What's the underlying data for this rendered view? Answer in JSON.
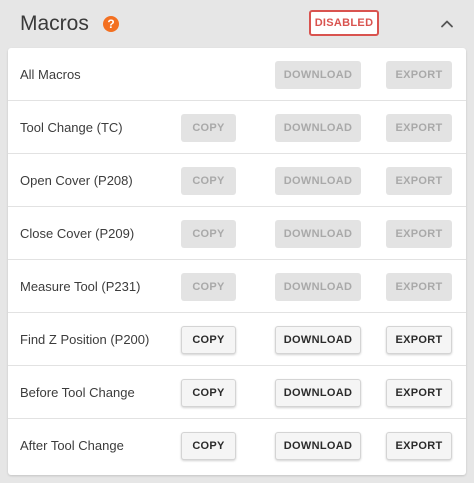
{
  "header": {
    "title": "Macros",
    "help_icon": "?",
    "status_badge": "DISABLED",
    "status_color": "#d9534f",
    "help_color": "#f37021"
  },
  "buttons": {
    "copy_label": "COPY",
    "download_label": "DOWNLOAD",
    "export_label": "EXPORT"
  },
  "macros": [
    {
      "label": "All Macros",
      "has_copy": false,
      "enabled": false
    },
    {
      "label": "Tool Change (TC)",
      "has_copy": true,
      "enabled": false
    },
    {
      "label": "Open Cover (P208)",
      "has_copy": true,
      "enabled": false
    },
    {
      "label": "Close Cover (P209)",
      "has_copy": true,
      "enabled": false
    },
    {
      "label": "Measure Tool (P231)",
      "has_copy": true,
      "enabled": false
    },
    {
      "label": "Find Z Position (P200)",
      "has_copy": true,
      "enabled": true
    },
    {
      "label": "Before Tool Change",
      "has_copy": true,
      "enabled": true
    },
    {
      "label": "After Tool Change",
      "has_copy": true,
      "enabled": true
    }
  ]
}
